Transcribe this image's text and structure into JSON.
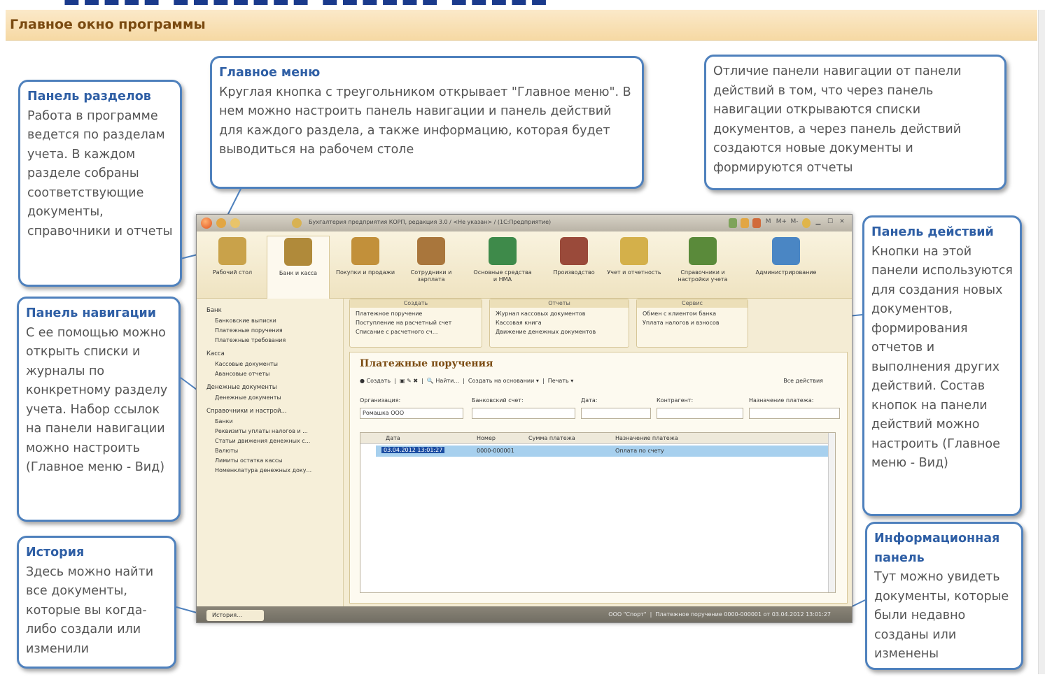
{
  "slide": {
    "title": "Главное окно программы"
  },
  "callouts": {
    "sections_panel": {
      "heading": "Панель разделов",
      "body": "Работа в программе ведется по разделам учета. В каждом разделе собраны соответствующие документы, справочники и отчеты"
    },
    "main_menu": {
      "heading": "Главное меню",
      "body": "Круглая кнопка с треугольником открывает \"Главное меню\". В нем можно настроить панель навигации и панель действий для каждого раздела, а также информацию, которая будет выводиться на рабочем столе"
    },
    "difference": {
      "body": "Отличие панели навигации от панели действий в том, что через панель навигации открываются списки документов, а через панель действий создаются новые документы и формируются отчеты"
    },
    "actions_panel": {
      "heading": "Панель действий",
      "body": "Кнопки на этой панели используются для создания новых документов, формирования отчетов и выполнения других действий. Состав кнопок на панели действий можно настроить (Главное меню - Вид)"
    },
    "nav_panel": {
      "heading": "Панель навигации",
      "body": "С ее помощью можно открыть списки и журналы по конкретному разделу учета. Набор ссылок на панели навигации можно настроить (Главное меню - Вид)"
    },
    "history": {
      "heading": "История",
      "body": "Здесь можно найти все документы, которые вы когда-либо создали или изменили"
    },
    "info_panel": {
      "heading": "Информационная панель",
      "body": "Тут можно увидеть документы, которые были недавно созданы или изменены"
    }
  },
  "window": {
    "title": "Бухгалтерия предприятия КОРП, редакция 3.0 / <Не указан> / (1С:Предприятие)",
    "toolbar_right": [
      "M",
      "M+",
      "M-"
    ],
    "sections": [
      {
        "label": "Рабочий стол",
        "color": "#c9a24a"
      },
      {
        "label": "Банк и касса",
        "color": "#b08a3a"
      },
      {
        "label": "Покупки и продажи",
        "color": "#c2903a"
      },
      {
        "label": "Сотрудники и зарплата",
        "color": "#a9763c"
      },
      {
        "label": "Основные средства и НМА",
        "color": "#3e8a4a"
      },
      {
        "label": "Производство",
        "color": "#9a4a3a"
      },
      {
        "label": "Учет и отчетность",
        "color": "#d4b04a"
      },
      {
        "label": "Справочники и настройки учета",
        "color": "#5a8a3a"
      },
      {
        "label": "Администрирование",
        "color": "#4a86c4"
      }
    ],
    "nav": [
      {
        "group": "Банк",
        "items": [
          "Банковские выписки",
          "Платежные поручения",
          "Платежные требования"
        ]
      },
      {
        "group": "Касса",
        "items": [
          "Кассовые документы",
          "Авансовые отчеты"
        ]
      },
      {
        "group": "Денежные документы",
        "items": [
          "Денежные документы"
        ]
      },
      {
        "group": "Справочники и настрой...",
        "items": [
          "Банки",
          "Реквизиты уплаты налогов и ...",
          "Статьи движения денежных с...",
          "Валюты",
          "Лимиты остатка кассы",
          "Номенклатура денежных доку..."
        ]
      }
    ],
    "action_groups": [
      {
        "header": "Создать",
        "items": [
          "Платежное поручение",
          "Поступление на расчетный счет",
          "Списание с расчетного сч..."
        ]
      },
      {
        "header": "Отчеты",
        "items": [
          "Журнал кассовых документов",
          "Кассовая книга",
          "Движение денежных документов"
        ]
      },
      {
        "header": "Сервис",
        "items": [
          "Обмен с клиентом банка",
          "Уплата налогов и взносов"
        ]
      }
    ],
    "form": {
      "title": "Платежные поручения",
      "toolbar": {
        "create": "Создать",
        "find": "Найти...",
        "create_based": "Создать на основании",
        "print": "Печать",
        "all_actions": "Все действия"
      },
      "filters": [
        {
          "label": "Организация:",
          "value": "Ромашка ООО"
        },
        {
          "label": "Банковский счет:",
          "value": ""
        },
        {
          "label": "Дата:",
          "value": ""
        },
        {
          "label": "Контрагент:",
          "value": ""
        },
        {
          "label": "Назначение платежа:",
          "value": ""
        }
      ],
      "columns": [
        "Дата",
        "Номер",
        "Сумма платежа",
        "Назначение платежа"
      ],
      "rows": [
        {
          "date": "03.04.2012 13:01:27",
          "number": "0000-000001",
          "sum": "",
          "purpose": "Оплата по счету"
        }
      ]
    },
    "status": {
      "history_button": "История...",
      "org": "ООО \"Спорт\"",
      "last_doc": "Платежное поручение 0000-000001 от 03.04.2012 13:01:27"
    }
  }
}
